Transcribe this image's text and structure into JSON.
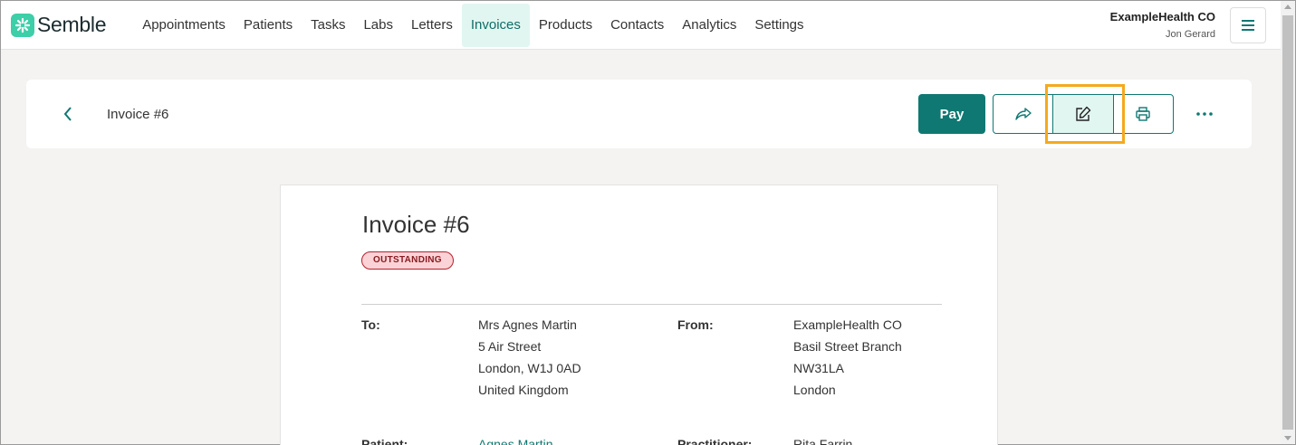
{
  "brand": {
    "name": "Semble"
  },
  "nav": {
    "items": [
      "Appointments",
      "Patients",
      "Tasks",
      "Labs",
      "Letters",
      "Invoices",
      "Products",
      "Contacts",
      "Analytics",
      "Settings"
    ],
    "active": "Invoices"
  },
  "account": {
    "org": "ExampleHealth CO",
    "user": "Jon Gerard"
  },
  "header": {
    "title": "Invoice #6",
    "pay_label": "Pay"
  },
  "invoice": {
    "title": "Invoice #6",
    "status": "OUTSTANDING",
    "to_label": "To:",
    "to_lines": [
      "Mrs Agnes Martin",
      "5 Air Street",
      "London, W1J 0AD",
      "United Kingdom"
    ],
    "from_label": "From:",
    "from_lines": [
      "ExampleHealth CO",
      "Basil Street Branch",
      "NW31LA",
      "London"
    ],
    "patient_label": "Patient:",
    "patient_name": "Agnes Martin",
    "practitioner_label": "Practitioner:",
    "practitioner_name": "Rita Farrin"
  },
  "colors": {
    "accent": "#0f7872",
    "highlight": "#f5a91d",
    "status_bg": "#fbd3d6"
  }
}
